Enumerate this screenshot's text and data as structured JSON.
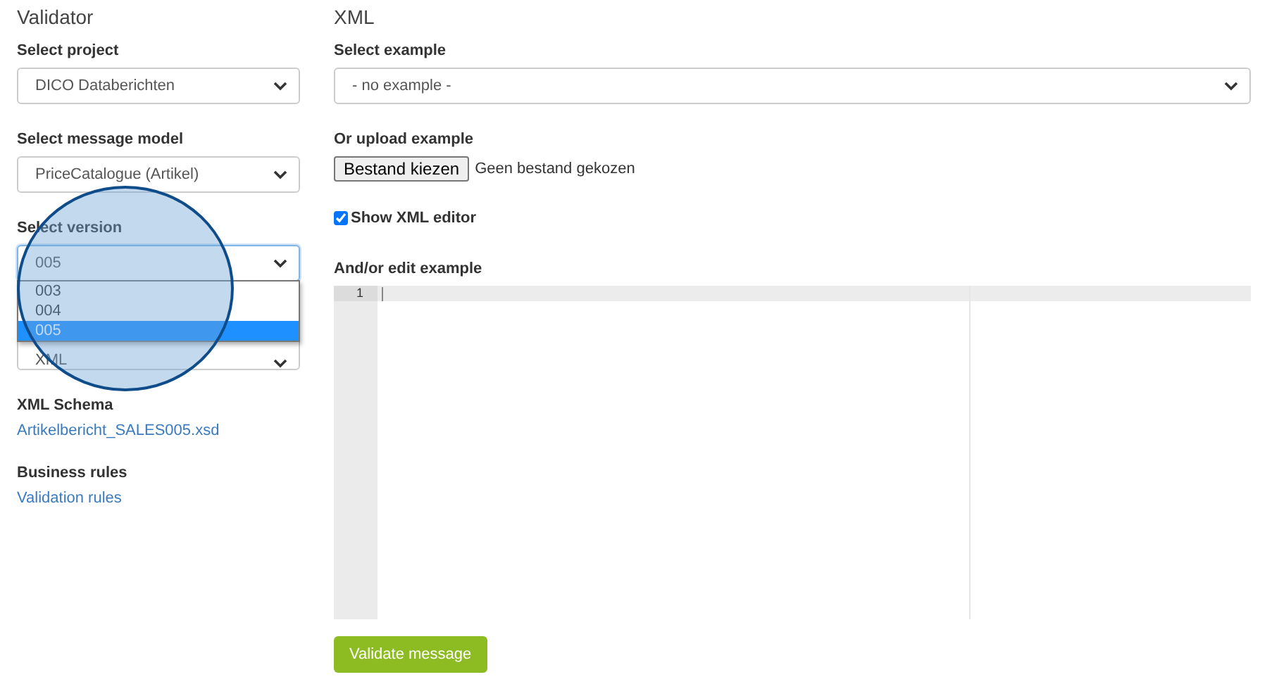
{
  "validator": {
    "title": "Validator",
    "selects": [
      {
        "label": "Select project",
        "value": "DICO Databerichten",
        "focused": false
      },
      {
        "label": "Select message model",
        "value": "PriceCatalogue (Artikel)",
        "focused": false
      },
      {
        "label": "Select version",
        "value": "005",
        "focused": true,
        "open": true,
        "options": [
          {
            "label": "003",
            "selected": false
          },
          {
            "label": "004",
            "selected": false
          },
          {
            "label": "005",
            "selected": true
          }
        ]
      },
      {
        "value": "XML",
        "focused": false
      }
    ],
    "links": [
      {
        "label": "XML Schema",
        "link": "Artikelbericht_SALES005.xsd"
      },
      {
        "label": "Business rules",
        "link": "Validation rules"
      }
    ]
  },
  "xml": {
    "title": "XML",
    "example_label": "Select example",
    "example_value": "- no example -",
    "upload_label": "Or upload example",
    "file_button": "Bestand kiezen",
    "file_status": "Geen bestand gekozen",
    "show_editor": {
      "label": "Show XML editor",
      "checked": true
    },
    "editor_label": "And/or edit example",
    "line_numbers": [
      "1"
    ],
    "submit": "Validate message"
  }
}
